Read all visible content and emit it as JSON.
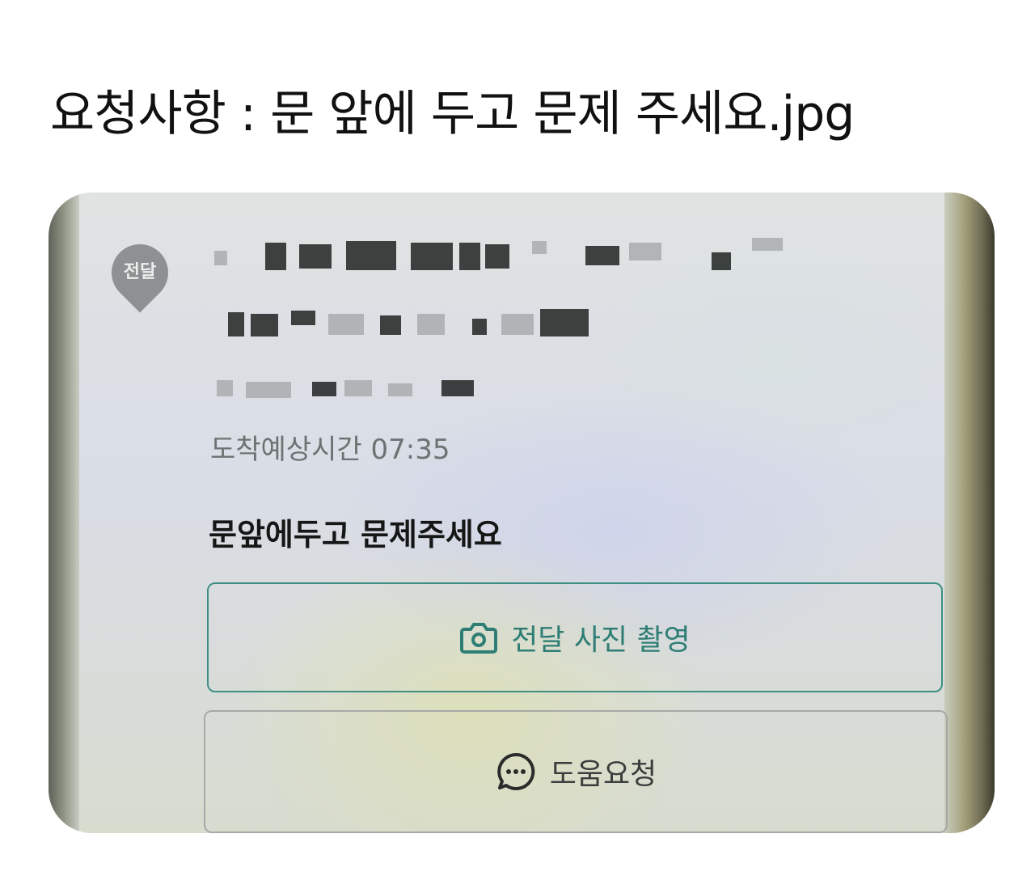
{
  "caption": "요청사항 : 문 앞에 두고 문제 주세요.jpg",
  "badge": {
    "label": "전달"
  },
  "delivery": {
    "eta_text": "도착예상시간 07:35",
    "request_note": "문앞에두고 문제주세요"
  },
  "buttons": {
    "photo": {
      "label": "전달 사진 촬영",
      "icon": "camera-icon"
    },
    "help": {
      "label": "도움요청",
      "icon": "chat-bubble-icon"
    }
  },
  "colors": {
    "accent": "#2f7e75",
    "badge": "#8e9192"
  }
}
